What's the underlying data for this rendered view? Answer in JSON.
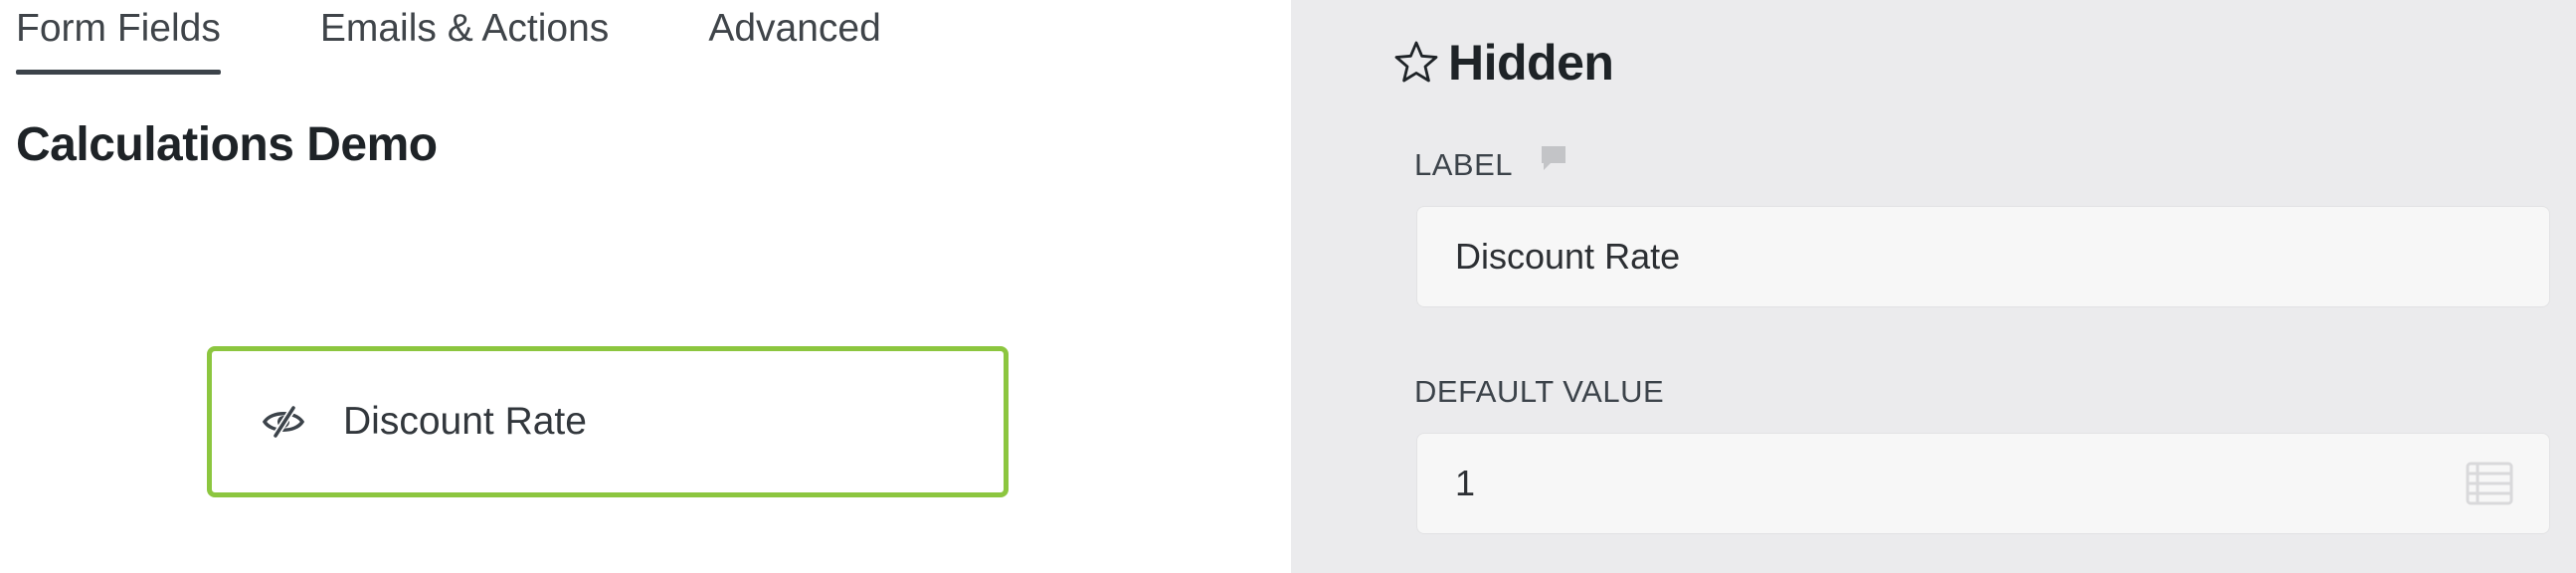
{
  "tabs": [
    {
      "label": "Form Fields",
      "active": true
    },
    {
      "label": "Emails & Actions",
      "active": false
    },
    {
      "label": "Advanced",
      "active": false
    }
  ],
  "form": {
    "title": "Calculations Demo",
    "fields": [
      {
        "label": "Discount Rate",
        "icon": "hidden-eye-icon",
        "selected": true
      }
    ]
  },
  "settings_panel": {
    "title": "Hidden",
    "title_icon": "star-outline-icon",
    "label_field": {
      "label": "LABEL",
      "help_icon": "speech-bubble-icon",
      "value": "Discount Rate"
    },
    "default_value_field": {
      "label": "DEFAULT VALUE",
      "value": "1",
      "action_icon": "merge-tags-icon"
    }
  },
  "colors": {
    "accent_selected": "#8cc63f",
    "settings_bg": "#ebebed",
    "input_bg": "#f7f7f7"
  }
}
